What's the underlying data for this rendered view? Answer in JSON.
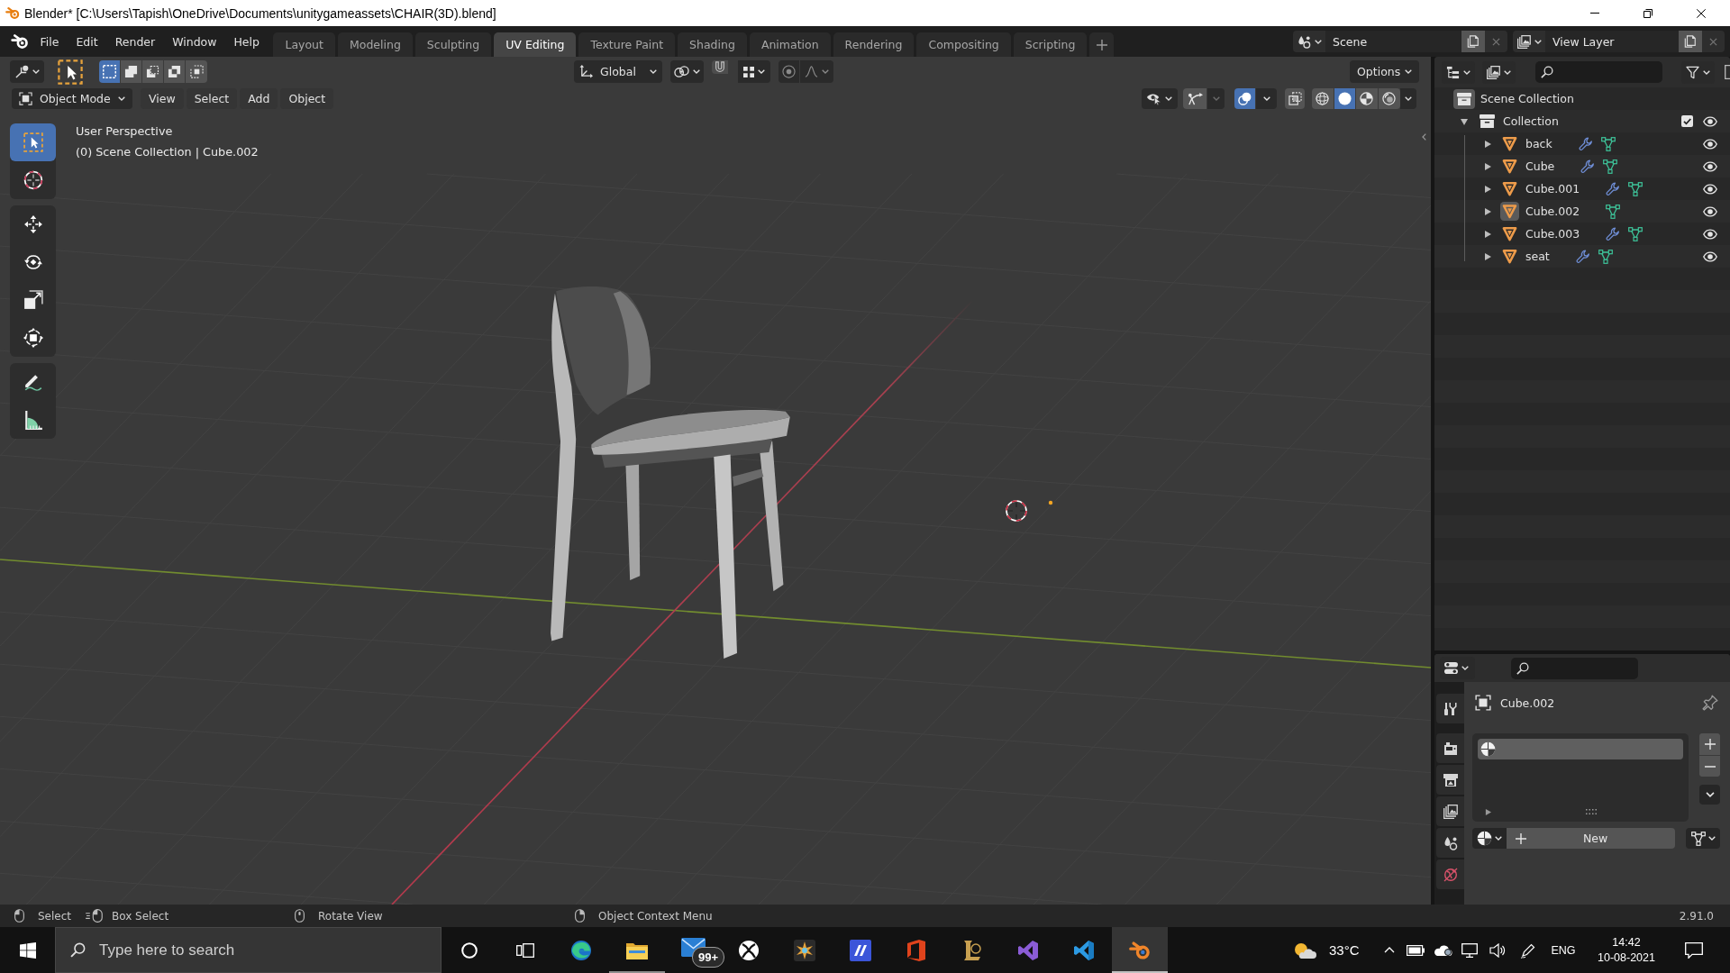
{
  "window": {
    "title": "Blender* [C:\\Users\\Tapish\\OneDrive\\Documents\\unitygameassets\\CHAIR(3D).blend]"
  },
  "menu": [
    "File",
    "Edit",
    "Render",
    "Window",
    "Help"
  ],
  "workspaces": [
    {
      "label": "Layout",
      "selected": false
    },
    {
      "label": "Modeling",
      "selected": false
    },
    {
      "label": "Sculpting",
      "selected": false
    },
    {
      "label": "UV Editing",
      "selected": true
    },
    {
      "label": "Texture Paint",
      "selected": false
    },
    {
      "label": "Shading",
      "selected": false
    },
    {
      "label": "Animation",
      "selected": false
    },
    {
      "label": "Rendering",
      "selected": false
    },
    {
      "label": "Compositing",
      "selected": false
    },
    {
      "label": "Scripting",
      "selected": false
    }
  ],
  "scene": {
    "name": "Scene"
  },
  "view_layer": {
    "name": "View Layer"
  },
  "viewport": {
    "tool_header": {
      "select_modes": [
        {
          "selected": true
        },
        {
          "selected": false
        },
        {
          "selected": false
        },
        {
          "selected": false
        },
        {
          "selected": false
        }
      ],
      "orientation": "Global",
      "options": "Options"
    },
    "header": {
      "mode": "Object Mode",
      "menus": [
        "View",
        "Select",
        "Add",
        "Object"
      ],
      "gizmos": {
        "on": true
      },
      "overlays": {
        "on": true
      },
      "xray": {
        "on": false
      },
      "shading": [
        {
          "selected": false
        },
        {
          "selected": true
        },
        {
          "selected": false
        },
        {
          "selected": false
        }
      ]
    },
    "info": [
      "User Perspective",
      "(0) Scene Collection | Cube.002"
    ],
    "tools": [
      {
        "selected": true
      },
      {
        "selected": false
      },
      {
        "selected": false
      },
      {
        "selected": false
      },
      {
        "selected": false
      },
      {
        "selected": false
      },
      {
        "selected": false
      },
      {
        "selected": false
      }
    ]
  },
  "outliner": {
    "root": "Scene Collection",
    "collections": [
      {
        "name": "Collection",
        "expanded": true,
        "checked": true,
        "visible": true,
        "children": [
          {
            "name": "back",
            "expanded": false,
            "has_modifiers": true,
            "active": false,
            "visible": true
          },
          {
            "name": "Cube",
            "expanded": false,
            "has_modifiers": true,
            "active": false,
            "visible": true
          },
          {
            "name": "Cube.001",
            "expanded": false,
            "has_modifiers": true,
            "active": false,
            "visible": true
          },
          {
            "name": "Cube.002",
            "expanded": false,
            "has_modifiers": false,
            "active": true,
            "visible": true
          },
          {
            "name": "Cube.003",
            "expanded": false,
            "has_modifiers": true,
            "active": false,
            "visible": true
          },
          {
            "name": "seat",
            "expanded": false,
            "has_modifiers": true,
            "active": false,
            "visible": true
          }
        ]
      }
    ]
  },
  "properties": {
    "object": "Cube.002",
    "material_slots": [
      {
        "selected": true
      }
    ],
    "new_button": "New"
  },
  "status_bar": {
    "hints": [
      "Select",
      "Box Select",
      "Rotate View",
      "Object Context Menu"
    ],
    "version": "2.91.0"
  },
  "taskbar": {
    "search_placeholder": "Type here to search",
    "apps": [
      {
        "running": false,
        "active": false
      },
      {
        "running": true,
        "active": false
      },
      {
        "running": false,
        "active": false,
        "badge": "99+"
      },
      {
        "running": false,
        "active": false
      },
      {
        "running": false,
        "active": false
      },
      {
        "running": false,
        "active": false
      },
      {
        "running": false,
        "active": false
      },
      {
        "running": false,
        "active": false
      },
      {
        "running": false,
        "active": false
      },
      {
        "running": false,
        "active": false
      },
      {
        "running": true,
        "active": true
      }
    ],
    "weather": "33°C",
    "language": "ENG",
    "time": "14:42",
    "date": "10-08-2021"
  }
}
